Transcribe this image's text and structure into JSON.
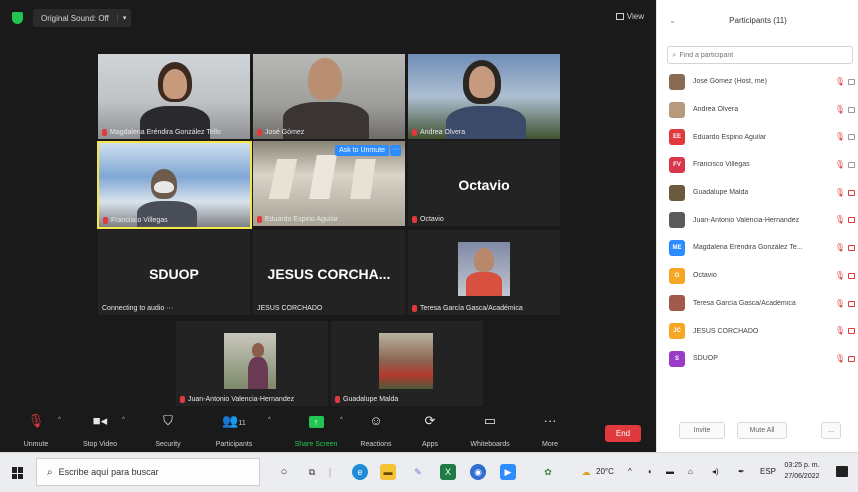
{
  "topbar": {
    "original_sound": "Original Sound: Off",
    "view_label": "View"
  },
  "tiles": [
    {
      "name": "Magdalena Eréndira González Tello"
    },
    {
      "name": "José Gómez"
    },
    {
      "name": "Andrea Olvera"
    },
    {
      "name": "Francisco Villegas"
    },
    {
      "name": "Eduardo Espino Aguilar",
      "ask_unmute": "Ask to Unmute",
      "more": "···"
    },
    {
      "name": "Octavio",
      "display_name": "Octavio"
    },
    {
      "display_name": "SDUOP",
      "status": "Connecting to audio ···"
    },
    {
      "name": "JESUS CORCHADO",
      "display_name": "JESUS  CORCHA..."
    },
    {
      "name": "Teresa García Gasca/Académica"
    },
    {
      "name": "Juan-Antonio Valencia-Hernandez"
    },
    {
      "name": "Guadalupe Malda"
    }
  ],
  "toolbar": {
    "unmute": "Unmute",
    "stop_video": "Stop Video",
    "security": "Security",
    "participants": "Participants",
    "participants_count": "11",
    "share_screen": "Share Screen",
    "reactions": "Reactions",
    "apps": "Apps",
    "whiteboards": "Whiteboards",
    "more": "More",
    "end": "End"
  },
  "panel": {
    "title": "Participants (11)",
    "search_placeholder": "Find a participant",
    "participants": [
      {
        "name": "José Gómez (Host, me)",
        "initials": "",
        "color": "#8a6b52"
      },
      {
        "name": "Andrea Olvera",
        "initials": "",
        "color": "#b79a7c"
      },
      {
        "name": "Eduardo Espino Aguilar",
        "initials": "EE",
        "color": "#e0393e"
      },
      {
        "name": "Francisco Villegas",
        "initials": "FV",
        "color": "#d9364b"
      },
      {
        "name": "Guadalupe Malda",
        "initials": "",
        "color": "#6b5a3e"
      },
      {
        "name": "Juan-Antonio Valencia-Hernandez",
        "initials": "",
        "color": "#5a5a5a"
      },
      {
        "name": "Magdalena Eréndira González Te...",
        "initials": "ME",
        "color": "#2d8cff"
      },
      {
        "name": "Octavio",
        "initials": "O",
        "color": "#f5a623"
      },
      {
        "name": "Teresa García Gasca/Académica",
        "initials": "",
        "color": "#a05a4a"
      },
      {
        "name": "JESUS CORCHADO",
        "initials": "JC",
        "color": "#f5a623"
      },
      {
        "name": "SDUOP",
        "initials": "S",
        "color": "#9b3cc9"
      }
    ],
    "invite": "Invite",
    "mute_all": "Mute All",
    "more": "..."
  },
  "taskbar": {
    "search_text": "Escribe aquí para buscar",
    "weather": "20°C",
    "language": "ESP",
    "time": "03:25 p. m.",
    "date": "27/06/2022"
  },
  "colors": {
    "meeting_bg": "#1a1a1a",
    "active_speaker": "#f2e64a",
    "muted_red": "#e0393e",
    "share_green": "#23c552",
    "zoom_blue": "#2d8cff"
  }
}
